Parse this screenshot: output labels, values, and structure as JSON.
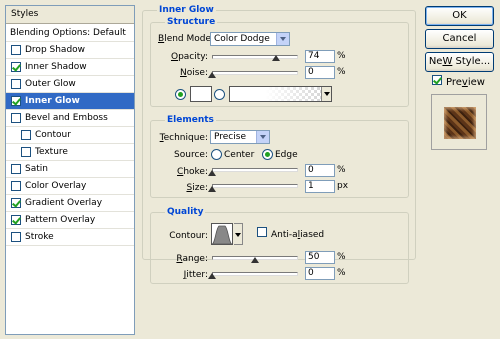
{
  "styles_panel": {
    "header": "Styles",
    "items": [
      {
        "label": "Blending Options: Default"
      },
      {
        "label": "Drop Shadow",
        "checked": false
      },
      {
        "label": "Inner Shadow",
        "checked": true
      },
      {
        "label": "Outer Glow",
        "checked": false
      },
      {
        "label": "Inner Glow",
        "checked": true,
        "selected": true
      },
      {
        "label": "Bevel and Emboss",
        "checked": false
      },
      {
        "label": "Contour",
        "checked": false
      },
      {
        "label": "Texture",
        "checked": false
      },
      {
        "label": "Satin",
        "checked": false
      },
      {
        "label": "Color Overlay",
        "checked": false
      },
      {
        "label": "Gradient Overlay",
        "checked": true
      },
      {
        "label": "Pattern Overlay",
        "checked": true
      },
      {
        "label": "Stroke",
        "checked": false
      }
    ]
  },
  "inner_glow": {
    "title": "Inner Glow",
    "structure": {
      "title": "Structure",
      "blend_mode_label_u": "B",
      "blend_mode_label_rest": "lend Mode:",
      "blend_mode_value": "Color Dodge",
      "opacity_label_u": "O",
      "opacity_label_rest": "pacity:",
      "opacity_value": "74",
      "opacity_unit": "%",
      "noise_label_u": "N",
      "noise_label_rest": "oise:",
      "noise_value": "0",
      "noise_unit": "%",
      "fill_mode": "color",
      "color": "#ffffff"
    },
    "elements": {
      "title": "Elements",
      "technique_label_u": "T",
      "technique_label_rest": "echnique:",
      "technique_value": "Precise",
      "source_label": "Source:",
      "source_center_label": "Center",
      "source_edge_label": "Edge",
      "source_value": "edge",
      "choke_label_u": "C",
      "choke_label_rest": "hoke:",
      "choke_value": "0",
      "choke_unit": "%",
      "size_label_u": "S",
      "size_label_rest": "ize:",
      "size_value": "1",
      "size_unit": "px"
    },
    "quality": {
      "title": "Quality",
      "contour_label": "Contour:",
      "anti_aliased_label_pre": "Anti-a",
      "anti_aliased_label_u": "l",
      "anti_aliased_label_rest": "iased",
      "anti_aliased": false,
      "range_label_u": "R",
      "range_label_rest": "ange:",
      "range_value": "50",
      "range_unit": "%",
      "jitter_label_u": "J",
      "jitter_label_rest": "itter:",
      "jitter_value": "0",
      "jitter_unit": "%"
    }
  },
  "buttons": {
    "ok": "OK",
    "cancel": "Cancel",
    "new_style_u": "W",
    "new_style_pre": "Ne",
    "new_style_rest": " Style...",
    "preview_label_u": "v",
    "preview_label_pre": "Pre",
    "preview_label_rest": "iew",
    "preview_checked": true
  }
}
